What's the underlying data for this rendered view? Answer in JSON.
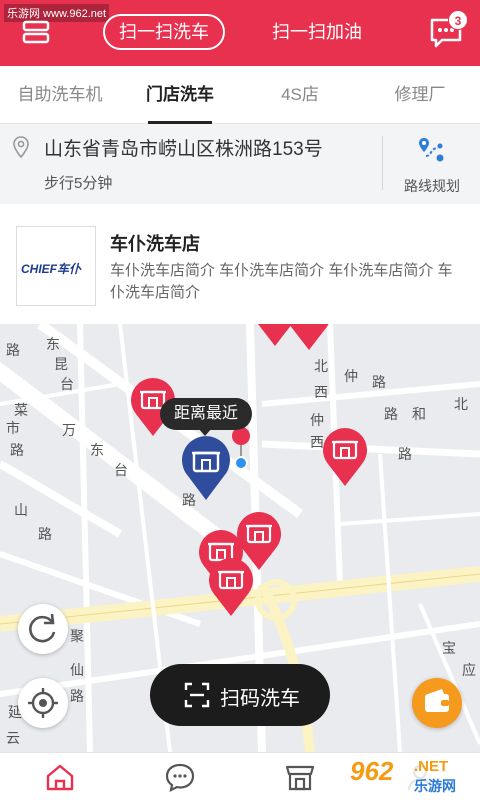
{
  "watermark": "乐游网 www.962.net",
  "header": {
    "scan_wash_label": "扫一扫洗车",
    "scan_fuel_label": "扫一扫加油",
    "message_count": "3",
    "accent_color": "#e8304f"
  },
  "tabs": [
    {
      "label": "自助洗车机",
      "active": false
    },
    {
      "label": "门店洗车",
      "active": true
    },
    {
      "label": "4S店",
      "active": false
    },
    {
      "label": "修理厂",
      "active": false
    }
  ],
  "address": {
    "text": "山东省青岛市崂山区株洲路153号",
    "walk": "步行5分钟",
    "route_label": "路线规划"
  },
  "store": {
    "logo_text": "CHIEF车仆",
    "name": "车仆洗车店",
    "description": "车仆洗车店简介 车仆洗车店简介 车仆洗车店简介 车仆洗车店简介"
  },
  "map": {
    "tooltip": "距离最近",
    "scan_button_label": "扫码洗车",
    "marker_color": "#e8304f",
    "selected_marker_color": "#2f4d9c",
    "wallet_color": "#f59a1c"
  },
  "bottom_nav": [
    {
      "icon": "home-icon",
      "active": true
    },
    {
      "icon": "chat-icon",
      "active": false
    },
    {
      "icon": "store-icon",
      "active": false
    },
    {
      "icon": "user-icon",
      "active": false
    }
  ],
  "brand_watermark": {
    "number": "962",
    "net": ".NET",
    "name": "乐游网"
  }
}
